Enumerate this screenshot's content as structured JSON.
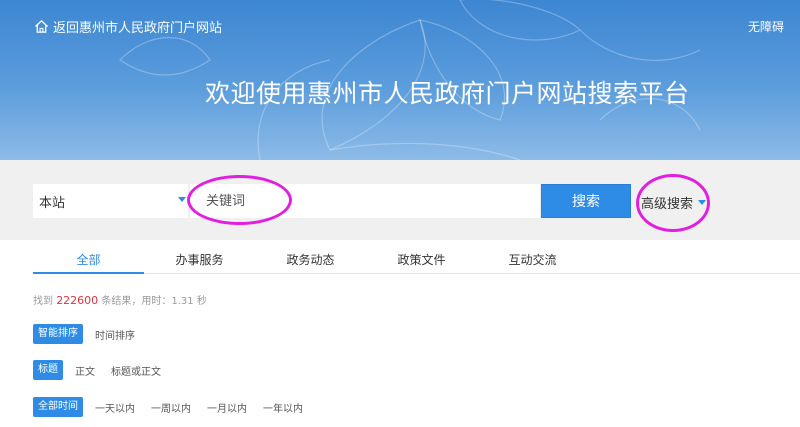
{
  "header": {
    "back_label": "返回惠州市人民政府门户网站",
    "accessibility_label": "无障碍",
    "welcome_title": "欢迎使用惠州市人民政府门户网站搜索平台"
  },
  "search": {
    "scope_value": "本站",
    "keyword_placeholder": "关键词",
    "keyword_value": "",
    "button_label": "搜索",
    "advanced_label": "高级搜索"
  },
  "tabs": [
    {
      "label": "全部",
      "active": true
    },
    {
      "label": "办事服务",
      "active": false
    },
    {
      "label": "政务动态",
      "active": false
    },
    {
      "label": "政策文件",
      "active": false
    },
    {
      "label": "互动交流",
      "active": false
    }
  ],
  "results": {
    "prefix": "找到",
    "count": "222600",
    "suffix": "条结果，用时：1.31 秒"
  },
  "filters": {
    "sort": [
      "智能排序",
      "时间排序"
    ],
    "field": [
      "标题",
      "正文",
      "标题或正文"
    ],
    "time": [
      "全部时间",
      "一天以内",
      "一周以内",
      "一月以内",
      "一年以内"
    ]
  },
  "colors": {
    "accent": "#2f8ce6",
    "highlight_circle": "#e21ee0",
    "result_count": "#e0333f"
  },
  "icons": {
    "home": "home-icon",
    "caret": "caret-down-icon"
  }
}
